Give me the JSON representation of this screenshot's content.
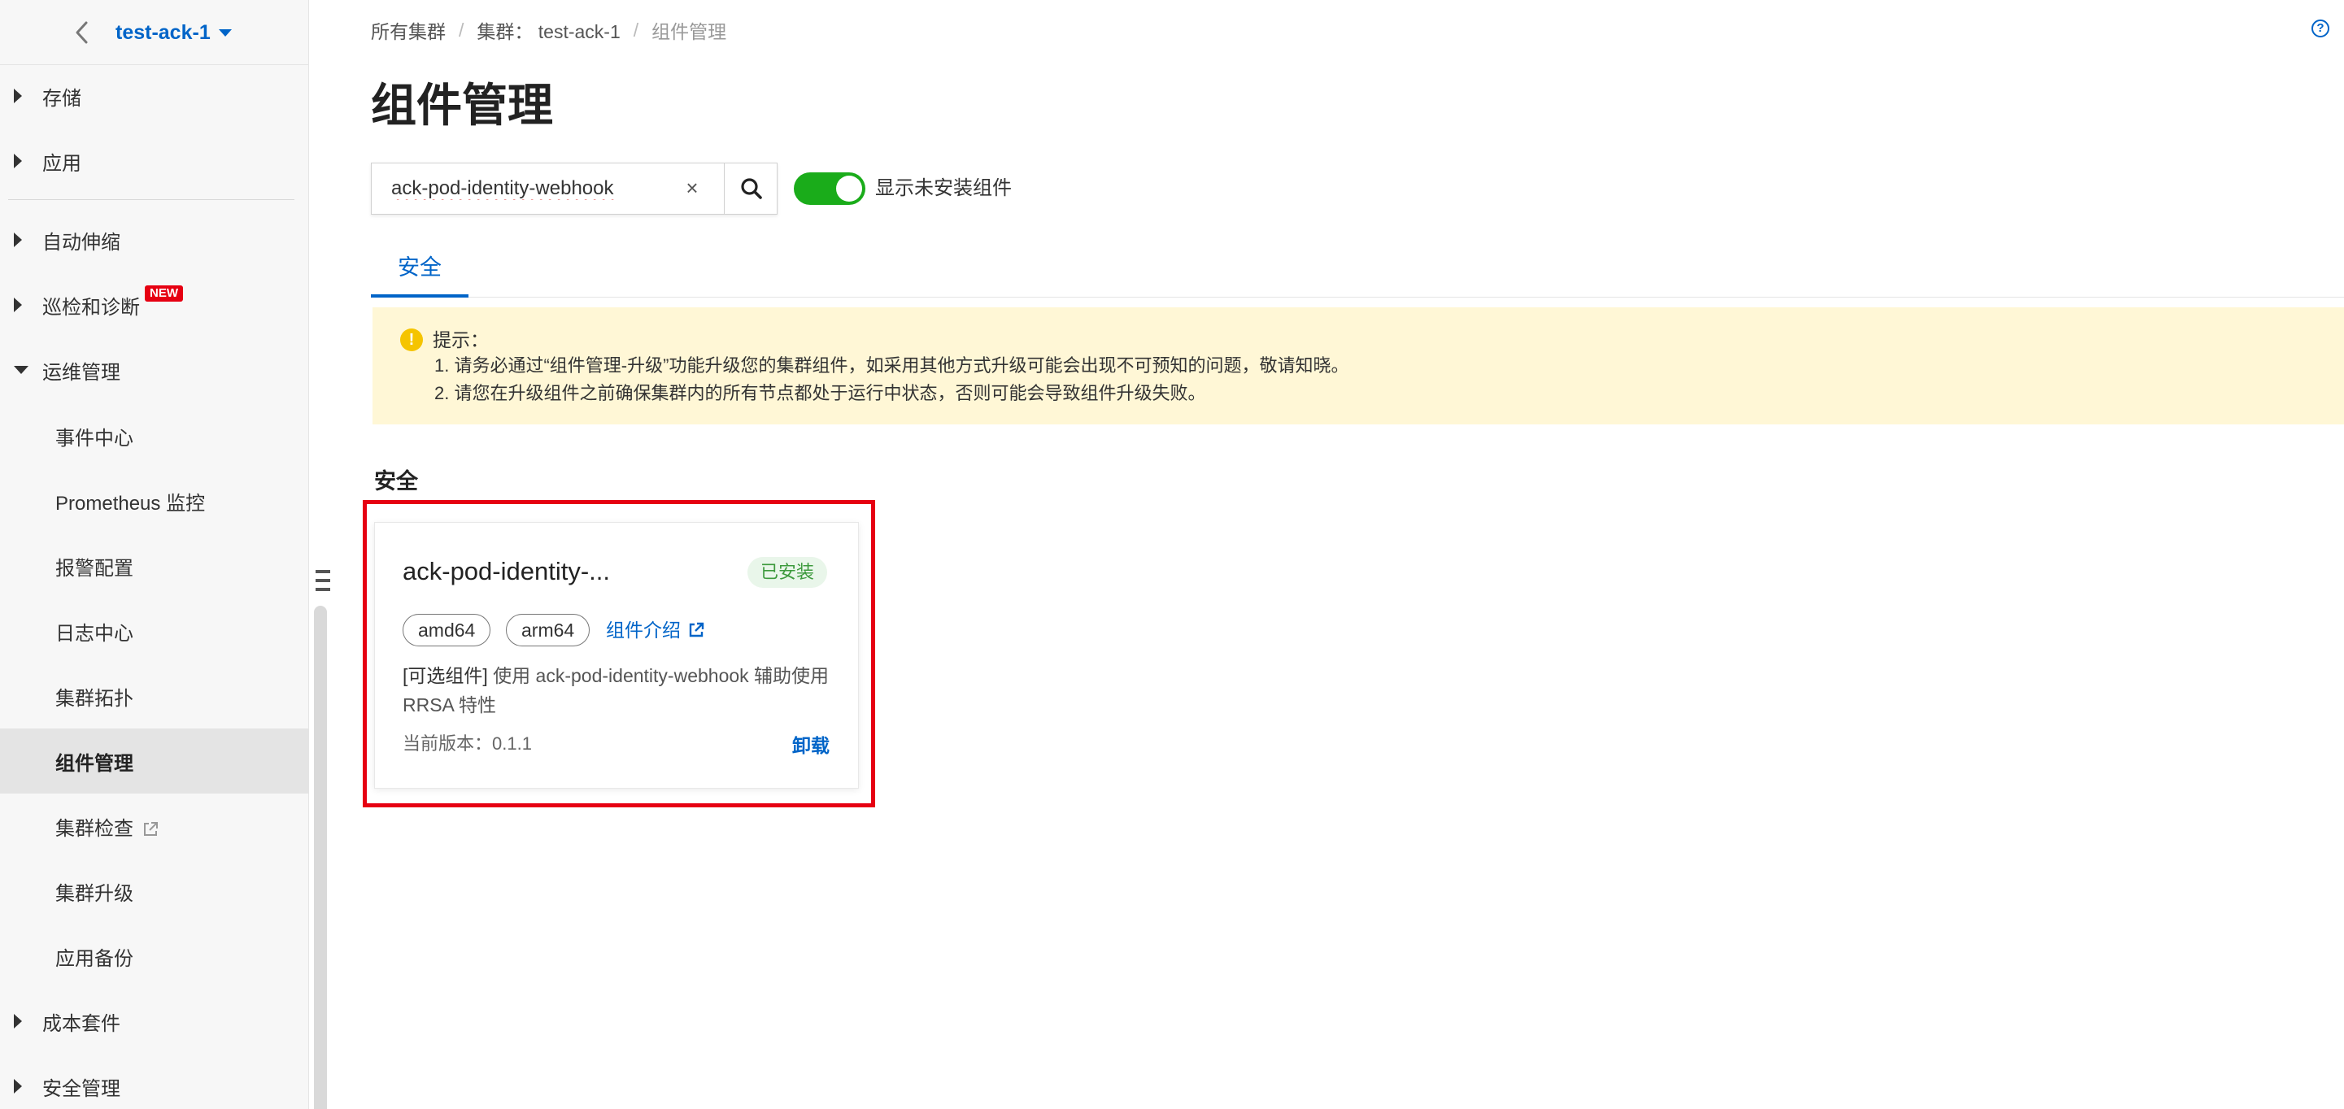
{
  "sidebar": {
    "cluster_name": "test-ack-1",
    "items": [
      {
        "label": "存储"
      },
      {
        "label": "应用"
      },
      {
        "label": "自动伸缩"
      },
      {
        "label": "巡检和诊断",
        "badge": "NEW"
      },
      {
        "label": "运维管理"
      },
      {
        "label": "事件中心"
      },
      {
        "label": "Prometheus 监控"
      },
      {
        "label": "报警配置"
      },
      {
        "label": "日志中心"
      },
      {
        "label": "集群拓扑"
      },
      {
        "label": "组件管理"
      },
      {
        "label": "集群检查"
      },
      {
        "label": "集群升级"
      },
      {
        "label": "应用备份"
      },
      {
        "label": "成本套件"
      },
      {
        "label": "安全管理"
      }
    ]
  },
  "breadcrumb": {
    "all_clusters": "所有集群",
    "cluster_prefix": "集群：",
    "cluster": "test-ack-1",
    "current": "组件管理"
  },
  "page": {
    "title": "组件管理"
  },
  "search": {
    "value": "ack-pod-identity-webhook",
    "clear": "×"
  },
  "toggle": {
    "label": "显示未安装组件",
    "on": true
  },
  "tabs": [
    {
      "label": "安全"
    }
  ],
  "notice": {
    "title": "提示：",
    "lines": [
      "1. 请务必通过“组件管理-升级”功能升级您的集群组件，如采用其他方式升级可能会出现不可预知的问题，敬请知晓。",
      "2. 请您在升级组件之前确保集群内的所有节点都处于运行中状态，否则可能会导致组件升级失败。"
    ]
  },
  "section": {
    "title": "安全"
  },
  "card": {
    "title": "ack-pod-identity-...",
    "status": "已安装",
    "tags": [
      "amd64",
      "arm64"
    ],
    "intro_link": "组件介绍",
    "desc_optional": "[可选组件]",
    "desc_text": " 使用 ack-pod-identity-webhook 辅助使用 RRSA 特性",
    "version": "当前版本：0.1.1",
    "action": "卸载"
  },
  "colors": {
    "accent": "#0064c8",
    "toggle_on": "#1aac1a",
    "highlight": "#e60012",
    "notice_bg": "#fff7d6"
  }
}
